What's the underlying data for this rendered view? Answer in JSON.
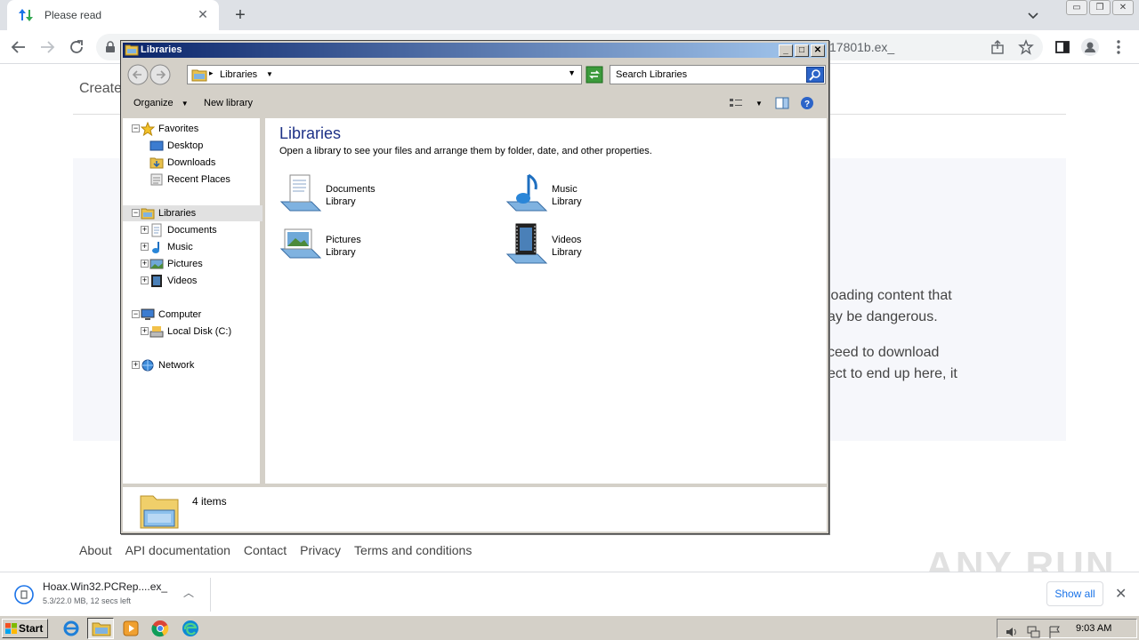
{
  "browser": {
    "tab_title": "Please read",
    "url_visible": "17801b.ex_",
    "tab_close": "✕",
    "new_tab": "+"
  },
  "page": {
    "create_text": "Create",
    "body_lines": [
      "loading content that",
      "ay be dangerous.",
      "ceed to download",
      "ect to end up here, it"
    ],
    "footer_links": [
      "About",
      "API documentation",
      "Contact",
      "Privacy",
      "Terms and conditions"
    ],
    "watermark": "ANY RUN"
  },
  "download": {
    "file_name": "Hoax.Win32.PCRep....ex_",
    "status": "5.3/22.0 MB, 12 secs left",
    "show_all": "Show all"
  },
  "taskbar": {
    "start_label": "Start",
    "clock": "9:03 AM"
  },
  "explorer": {
    "window_title": "Libraries",
    "address": "Libraries",
    "search_placeholder": "Search Libraries",
    "commands": {
      "organize": "Organize",
      "new_library": "New library"
    },
    "tree": [
      {
        "label": "Favorites",
        "level": 0,
        "expander": "−",
        "icon": "star-icon"
      },
      {
        "label": "Desktop",
        "level": 1,
        "expander": "",
        "icon": "desktop-icon"
      },
      {
        "label": "Downloads",
        "level": 1,
        "expander": "",
        "icon": "downloads-folder-icon"
      },
      {
        "label": "Recent Places",
        "level": 1,
        "expander": "",
        "icon": "recent-places-icon"
      },
      {
        "label": "Libraries",
        "level": 0,
        "expander": "−",
        "icon": "libraries-icon",
        "selected": true
      },
      {
        "label": "Documents",
        "level": 1,
        "expander": "+",
        "icon": "documents-icon"
      },
      {
        "label": "Music",
        "level": 1,
        "expander": "+",
        "icon": "music-icon"
      },
      {
        "label": "Pictures",
        "level": 1,
        "expander": "+",
        "icon": "pictures-icon"
      },
      {
        "label": "Videos",
        "level": 1,
        "expander": "+",
        "icon": "videos-icon"
      },
      {
        "label": "Computer",
        "level": 0,
        "expander": "−",
        "icon": "computer-icon"
      },
      {
        "label": "Local Disk (C:)",
        "level": 1,
        "expander": "+",
        "icon": "local-disk-icon"
      },
      {
        "label": "Network",
        "level": 0,
        "expander": "+",
        "icon": "network-icon"
      }
    ],
    "heading": "Libraries",
    "description": "Open a library to see your files and arrange them by folder, date, and other properties.",
    "libraries": [
      {
        "name": "Documents",
        "type": "Library",
        "icon": "documents-library-icon"
      },
      {
        "name": "Music",
        "type": "Library",
        "icon": "music-library-icon"
      },
      {
        "name": "Pictures",
        "type": "Library",
        "icon": "pictures-library-icon"
      },
      {
        "name": "Videos",
        "type": "Library",
        "icon": "videos-library-icon"
      }
    ],
    "status": "4 items"
  }
}
